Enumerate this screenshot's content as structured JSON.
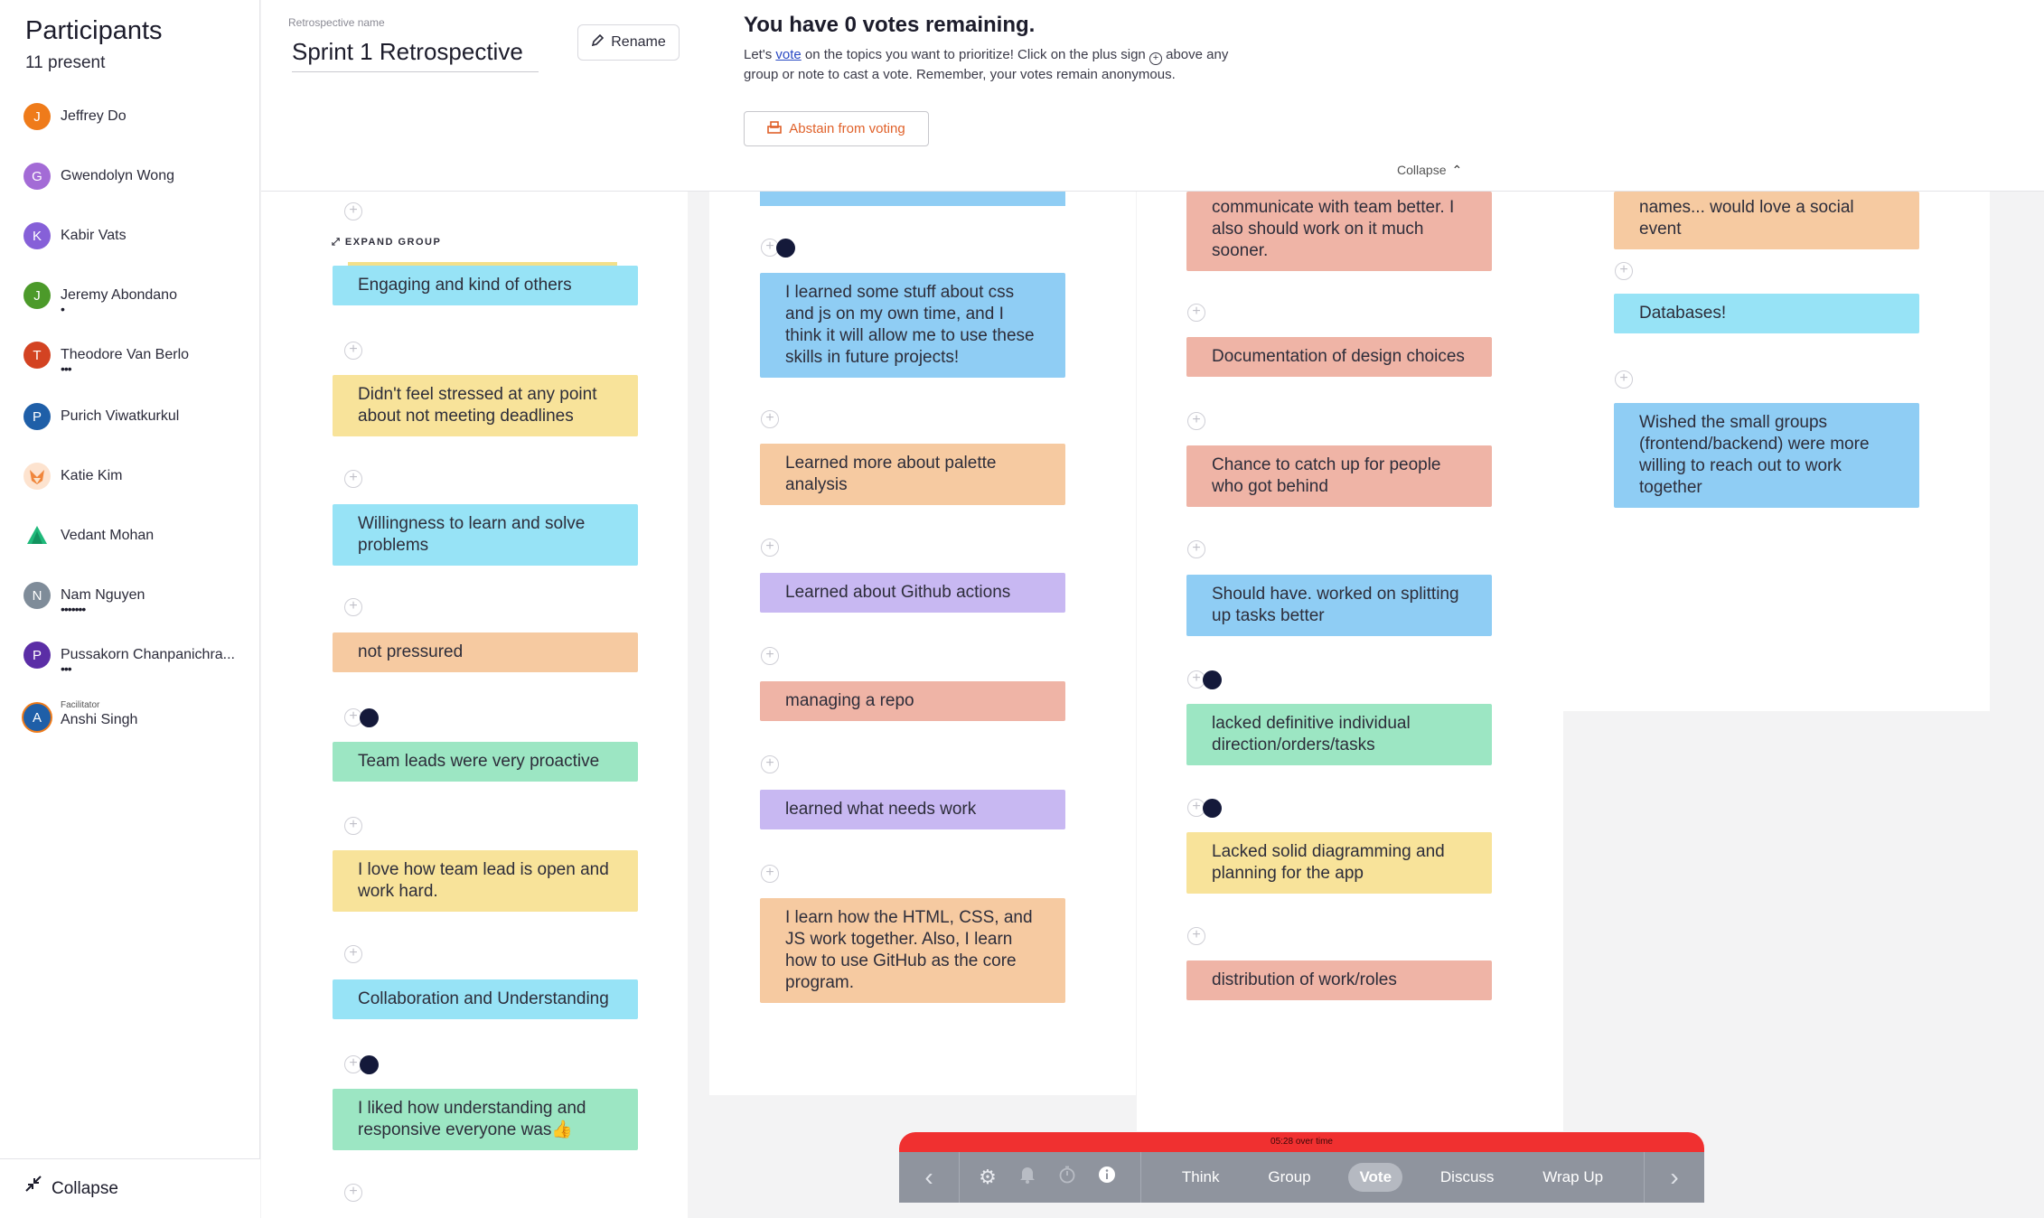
{
  "sidebar": {
    "title": "Participants",
    "count": "11 present",
    "participants": [
      {
        "initial": "J",
        "name": "Jeffrey Do",
        "dots": "",
        "color": "#ef7b1a"
      },
      {
        "initial": "G",
        "name": "Gwendolyn Wong",
        "dots": "",
        "color": "#a36bd6"
      },
      {
        "initial": "K",
        "name": "Kabir Vats",
        "dots": "",
        "color": "#8660d8"
      },
      {
        "initial": "J",
        "name": "Jeremy Abondano",
        "dots": "•",
        "color": "#4c9a2a"
      },
      {
        "initial": "T",
        "name": "Theodore Van Berlo",
        "dots": "•••",
        "color": "#d34322"
      },
      {
        "initial": "P",
        "name": "Purich Viwatkurkul",
        "dots": "",
        "color": "#1f5fa8"
      },
      {
        "initial": "",
        "name": "Katie Kim",
        "dots": "",
        "color": "#f4b183"
      },
      {
        "initial": "",
        "name": "Vedant Mohan",
        "dots": "",
        "color": "#1fb97a"
      },
      {
        "initial": "N",
        "name": "Nam Nguyen",
        "dots": "•••••••",
        "color": "#7f8c99"
      },
      {
        "initial": "P",
        "name": "Pussakorn Chanpanichra...",
        "dots": "•••",
        "color": "#5b2ea6"
      },
      {
        "initial": "A",
        "name": "Anshi Singh",
        "role": "Facilitator",
        "dots": "",
        "color": "#1f5fa8"
      }
    ],
    "collapse_label": "Collapse"
  },
  "header": {
    "retro_label": "Retrospective name",
    "retro_name": "Sprint 1 Retrospective",
    "rename_label": "Rename",
    "votes_title": "You have 0 votes remaining.",
    "votes_text_before": "Let's ",
    "votes_link": "vote",
    "votes_text_mid": " on the topics you want to prioritize! Click on the plus sign ",
    "votes_text_after": " above any group or note to cast a vote. Remember, your votes remain anonymous.",
    "abstain_label": "Abstain from voting",
    "collapse_label": "Collapse"
  },
  "columns": [
    {
      "expand_group_label": "EXPAND GROUP",
      "cards": [
        {
          "text": "Engaging and kind of others",
          "color": "cyan",
          "voted": false
        },
        {
          "text": "Didn't feel stressed at any point about not meeting deadlines",
          "color": "yellow",
          "voted": false
        },
        {
          "text": "Willingness to learn and solve problems",
          "color": "cyan",
          "voted": false
        },
        {
          "text": "not pressured",
          "color": "peach",
          "voted": false
        },
        {
          "text": "Team leads were very proactive",
          "color": "green",
          "voted": true
        },
        {
          "text": "I love how team lead is open and work hard.",
          "color": "yellow",
          "voted": false
        },
        {
          "text": "Collaboration and Understanding",
          "color": "cyan",
          "voted": false
        },
        {
          "text": "I liked how understanding and responsive everyone was👍",
          "color": "green",
          "voted": true
        }
      ]
    },
    {
      "cards": [
        {
          "text": "I learned some stuff about css and js on my own time, and I think it will allow me to use these skills in future projects!",
          "color": "blue",
          "voted": true
        },
        {
          "text": "Learned more about palette analysis",
          "color": "peach",
          "voted": false
        },
        {
          "text": "Learned about Github actions",
          "color": "purple",
          "voted": false
        },
        {
          "text": "managing a repo",
          "color": "salmon",
          "voted": false
        },
        {
          "text": "learned what needs work",
          "color": "purple",
          "voted": false
        },
        {
          "text": "I learn how the HTML, CSS, and JS work together. Also, I learn how to use GitHub as the core program.",
          "color": "peach",
          "voted": false
        }
      ]
    },
    {
      "cards": [
        {
          "text": "communicate with team better. I also should work on it much sooner.",
          "color": "salmon",
          "voted": false
        },
        {
          "text": "Documentation of design choices",
          "color": "salmon",
          "voted": false
        },
        {
          "text": "Chance to catch up for people who got behind",
          "color": "salmon",
          "voted": false
        },
        {
          "text": "Should have. worked on splitting up tasks better",
          "color": "blue",
          "voted": false
        },
        {
          "text": "lacked definitive individual direction/orders/tasks",
          "color": "green",
          "voted": true
        },
        {
          "text": "Lacked solid diagramming and planning for the app",
          "color": "yellow",
          "voted": true
        },
        {
          "text": "distribution of work/roles",
          "color": "salmon",
          "voted": false
        }
      ]
    },
    {
      "cards": [
        {
          "text": "names... would love a social event",
          "color": "peach",
          "voted": false
        },
        {
          "text": "Databases!",
          "color": "cyan",
          "voted": false
        },
        {
          "text": "Wished the small groups (frontend/backend) were more willing to reach out to work together",
          "color": "blue",
          "voted": false
        }
      ]
    }
  ],
  "phasebar": {
    "timer_text": "05:28 over time",
    "prev_icon": "chevron-left-icon",
    "next_icon": "chevron-right-icon",
    "icons": [
      "gear-icon",
      "bell-icon",
      "timer-icon",
      "info-icon"
    ],
    "tabs": [
      {
        "label": "Think",
        "active": false
      },
      {
        "label": "Group",
        "active": false
      },
      {
        "label": "Vote",
        "active": true
      },
      {
        "label": "Discuss",
        "active": false
      },
      {
        "label": "Wrap Up",
        "active": false
      }
    ]
  },
  "colors": {
    "timer_red": "#f03030",
    "accent_orange": "#e0612a",
    "vote_dot": "#14193a"
  }
}
